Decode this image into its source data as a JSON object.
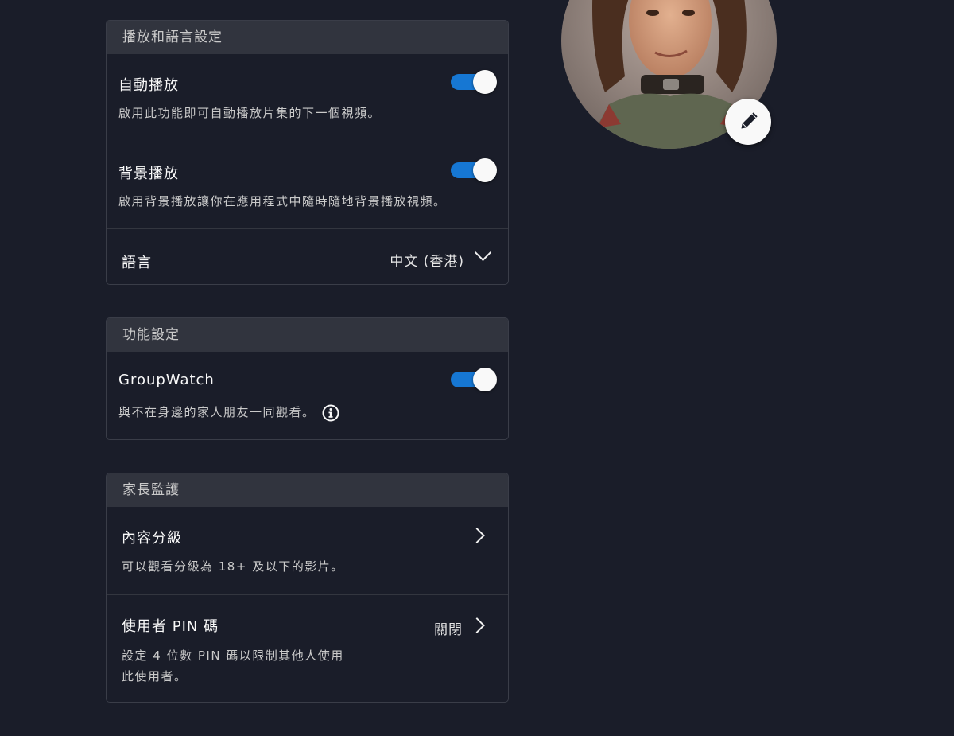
{
  "playback_section": {
    "header": "播放和語言設定",
    "autoplay": {
      "title": "自動播放",
      "description": "啟用此功能即可自動播放片集的下一個視頻。",
      "enabled": true
    },
    "background_play": {
      "title": "背景播放",
      "description": "啟用背景播放讓你在應用程式中隨時隨地背景播放視頻。",
      "enabled": true
    },
    "language": {
      "title": "語言",
      "value": "中文 (香港)"
    }
  },
  "feature_section": {
    "header": "功能設定",
    "groupwatch": {
      "title": "GroupWatch",
      "description": "與不在身邊的家人朋友一同觀看。",
      "enabled": true
    }
  },
  "parental_section": {
    "header": "家長監護",
    "content_rating": {
      "title": "內容分級",
      "description": "可以觀看分級為 18+ 及以下的影片。"
    },
    "profile_pin": {
      "title": "使用者 PIN 碼",
      "value": "關閉",
      "description_line1": "設定 4 位數 PIN 碼以限制其他人使用",
      "description_line2": "此使用者。"
    }
  },
  "avatar": {
    "icon": "profile-avatar",
    "edit_icon": "pencil-icon"
  },
  "colors": {
    "background": "#1a1d29",
    "section_header": "#31343e",
    "toggle_on": "#1677d3",
    "text_primary": "#f9f9f9",
    "text_secondary": "#cacaca"
  }
}
